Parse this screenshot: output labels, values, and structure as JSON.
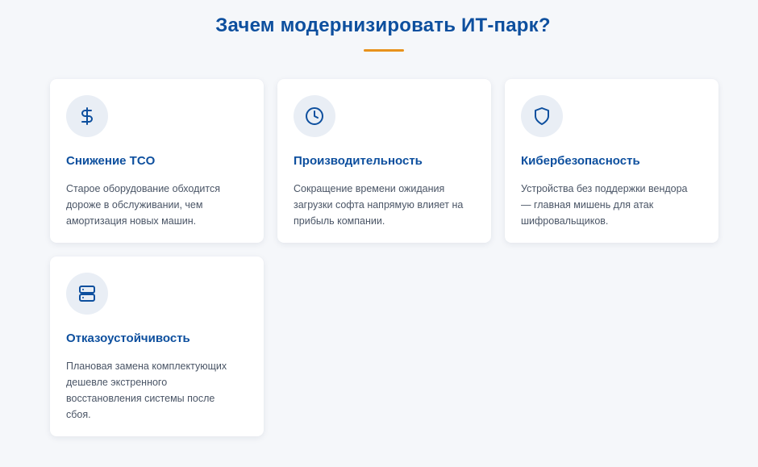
{
  "section": {
    "title": "Зачем модернизировать ИТ-парк?"
  },
  "colors": {
    "primary": "#0d4f9e",
    "accent": "#e8921c",
    "background": "#f5f7fa",
    "icon_bg": "#e9eef5",
    "text": "#4a5566"
  },
  "cards": [
    {
      "icon": "dollar-icon",
      "title": "Снижение TCO",
      "lines": [
        "Старое оборудование обходится",
        "дороже в обслуживании, чем",
        "амортизация новых машин."
      ]
    },
    {
      "icon": "clock-icon",
      "title": "Производительность",
      "lines": [
        "Сокращение времени ожидания",
        "загрузки софта напрямую влияет на",
        "прибыль компании."
      ]
    },
    {
      "icon": "shield-icon",
      "title": "Кибербезопасность",
      "lines": [
        "Устройства без поддержки вендора",
        "— главная мишень для атак",
        "шифровальщиков."
      ]
    },
    {
      "icon": "server-icon",
      "title": "Отказоустойчивость",
      "lines": [
        "Плановая замена комплектующих",
        "дешевле экстренного",
        "восстановления системы после",
        "сбоя."
      ]
    }
  ]
}
